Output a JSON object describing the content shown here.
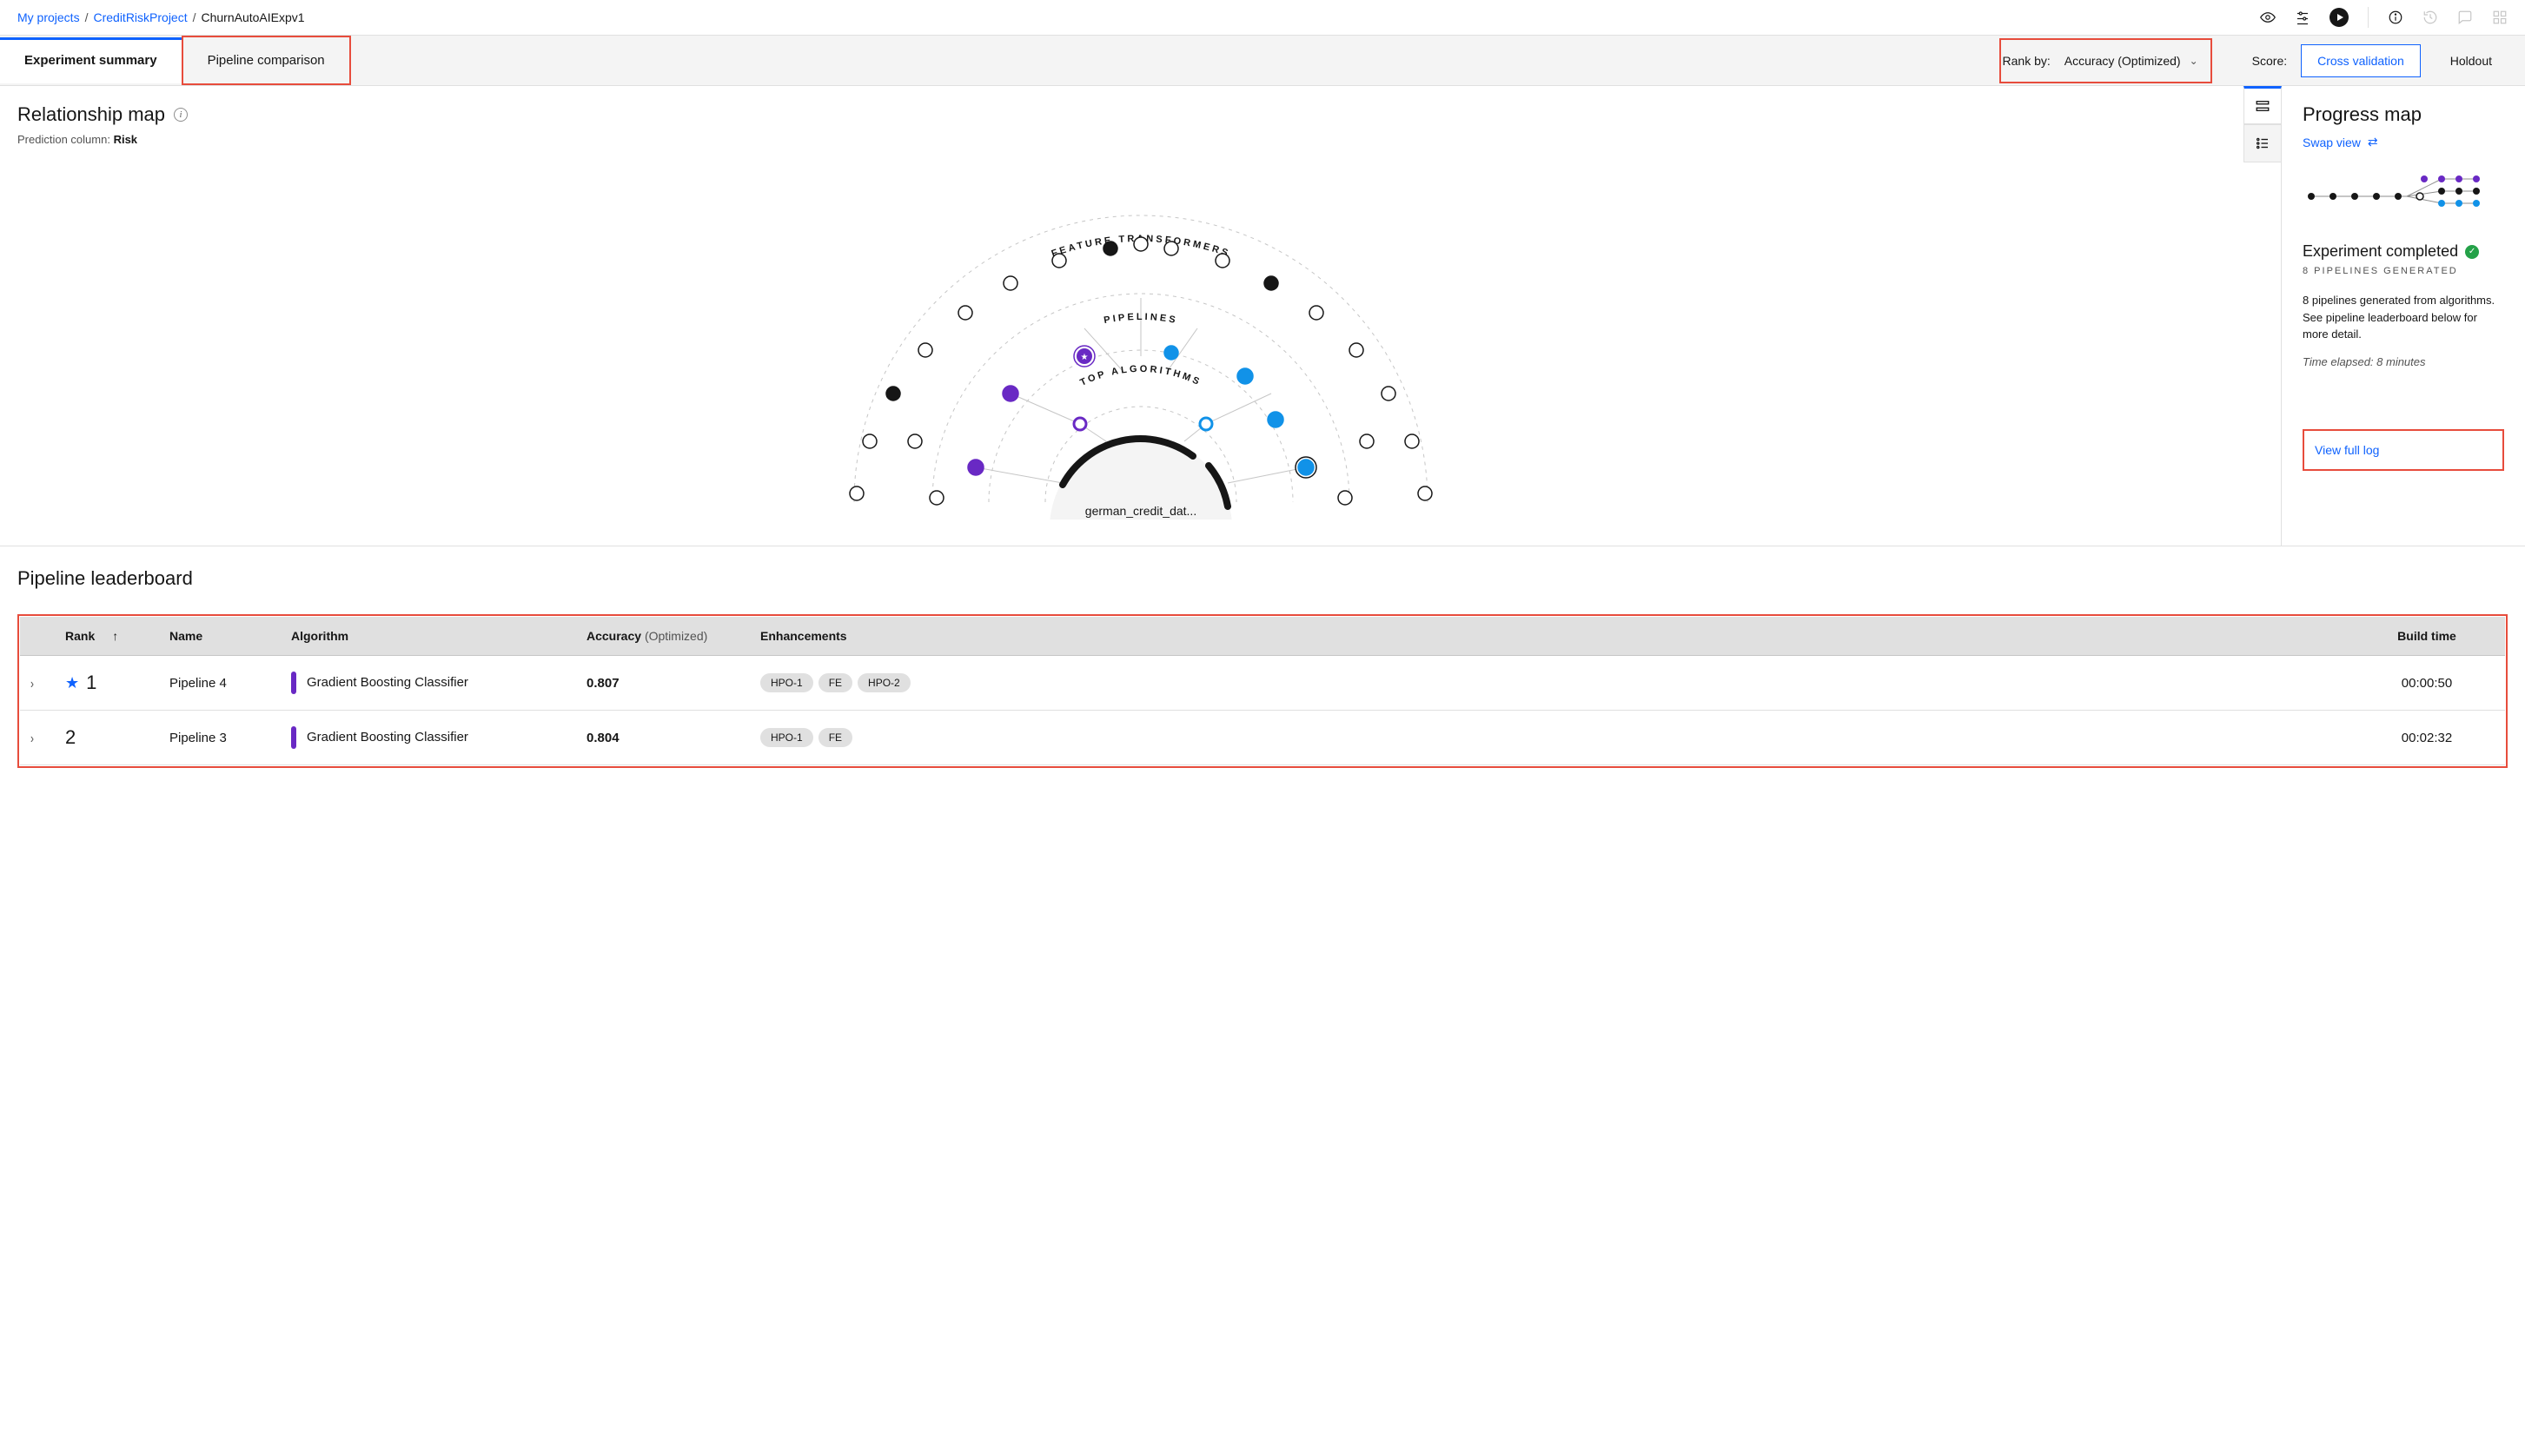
{
  "breadcrumb": {
    "root": "My projects",
    "project": "CreditRiskProject",
    "current": "ChurnAutoAIExpv1"
  },
  "tabs": {
    "summary": "Experiment summary",
    "compare": "Pipeline comparison"
  },
  "rankby": {
    "label": "Rank by:",
    "value": "Accuracy (Optimized)"
  },
  "score": {
    "label": "Score:",
    "cross": "Cross validation",
    "holdout": "Holdout"
  },
  "relationship": {
    "title": "Relationship map",
    "prediction_label": "Prediction column:",
    "prediction_value": "Risk",
    "ring_ft": "FEATURE TRANSFORMERS",
    "ring_pl": "PIPELINES",
    "ring_ta": "TOP ALGORITHMS",
    "center": "german_credit_dat..."
  },
  "progress": {
    "title": "Progress map",
    "swap": "Swap view",
    "done_title": "Experiment completed",
    "done_sub": "8 PIPELINES GENERATED",
    "desc": "8 pipelines generated from algorithms. See pipeline leaderboard below for more detail.",
    "elapsed": "Time elapsed: 8 minutes",
    "view_log": "View full log"
  },
  "leaderboard": {
    "title": "Pipeline leaderboard",
    "cols": {
      "rank": "Rank",
      "name": "Name",
      "algo": "Algorithm",
      "acc": "Accuracy",
      "acc_sub": "(Optimized)",
      "enh": "Enhancements",
      "bt": "Build time"
    },
    "rows": [
      {
        "rank": "1",
        "starred": true,
        "name": "Pipeline 4",
        "algo": "Gradient Boosting Classifier",
        "acc": "0.807",
        "enh": [
          "HPO-1",
          "FE",
          "HPO-2"
        ],
        "bt": "00:00:50"
      },
      {
        "rank": "2",
        "starred": false,
        "name": "Pipeline 3",
        "algo": "Gradient Boosting Classifier",
        "acc": "0.804",
        "enh": [
          "HPO-1",
          "FE"
        ],
        "bt": "00:02:32"
      }
    ]
  }
}
